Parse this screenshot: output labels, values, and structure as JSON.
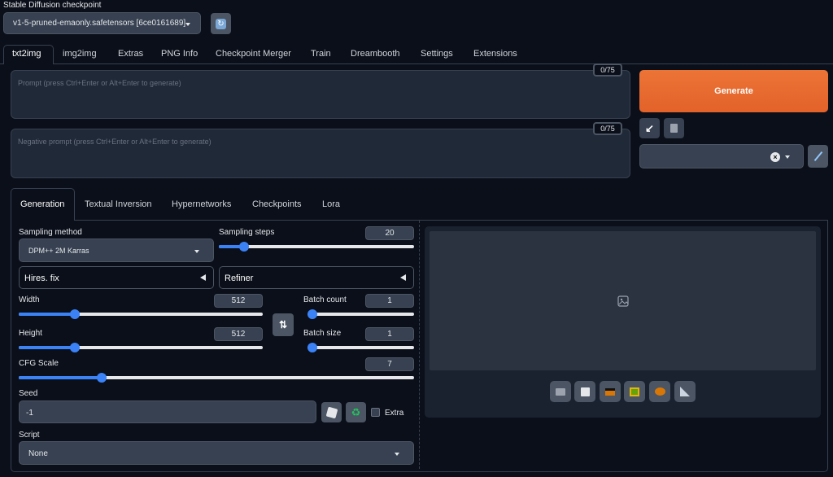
{
  "checkpoint": {
    "label": "Stable Diffusion checkpoint",
    "value": "v1-5-pruned-emaonly.safetensors [6ce0161689]"
  },
  "tabs": [
    "txt2img",
    "img2img",
    "Extras",
    "PNG Info",
    "Checkpoint Merger",
    "Train",
    "Dreambooth",
    "Settings",
    "Extensions"
  ],
  "prompt": {
    "placeholder": "Prompt (press Ctrl+Enter or Alt+Enter to generate)",
    "counter": "0/75"
  },
  "negative_prompt": {
    "placeholder": "Negative prompt (press Ctrl+Enter or Alt+Enter to generate)",
    "counter": "0/75"
  },
  "generate_label": "Generate",
  "subtabs": [
    "Generation",
    "Textual Inversion",
    "Hypernetworks",
    "Checkpoints",
    "Lora"
  ],
  "sampling_method": {
    "label": "Sampling method",
    "value": "DPM++ 2M Karras"
  },
  "sampling_steps": {
    "label": "Sampling steps",
    "value": "20",
    "fraction": 0.13
  },
  "hires_fix": "Hires. fix",
  "refiner": "Refiner",
  "width": {
    "label": "Width",
    "value": "512",
    "fraction": 0.23
  },
  "height": {
    "label": "Height",
    "value": "512",
    "fraction": 0.23
  },
  "batch_count": {
    "label": "Batch count",
    "value": "1",
    "fraction": 0.0
  },
  "batch_size": {
    "label": "Batch size",
    "value": "1",
    "fraction": 0.0
  },
  "cfg_scale": {
    "label": "CFG Scale",
    "value": "7",
    "fraction": 0.21
  },
  "seed": {
    "label": "Seed",
    "value": "-1",
    "extra_label": "Extra"
  },
  "script": {
    "label": "Script",
    "value": "None"
  },
  "colors": {
    "accent": "#3b82f6",
    "generate": "#ea6a2a"
  },
  "icons": [
    "refresh-icon",
    "arrow-down-left-icon",
    "trash-icon",
    "close-icon",
    "paintbrush-icon",
    "swap-icon",
    "dice-icon",
    "recycle-icon",
    "image-icon",
    "folder-icon",
    "save-icon",
    "zip-icon",
    "image-send-icon",
    "palette-icon",
    "ruler-icon"
  ]
}
